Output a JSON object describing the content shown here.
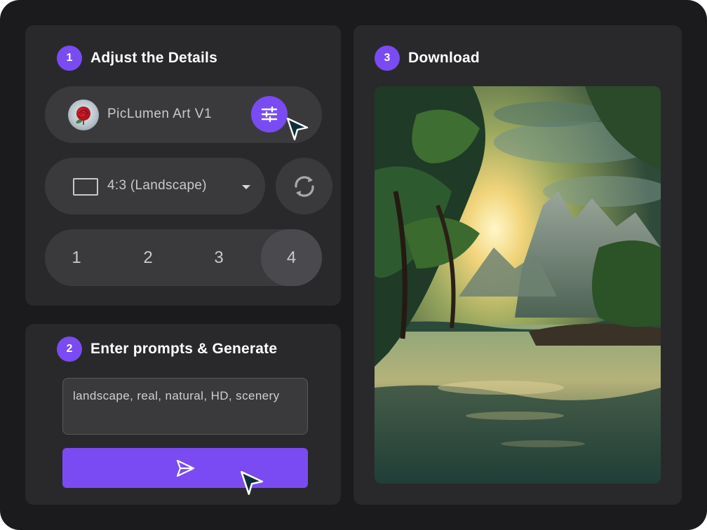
{
  "steps": {
    "step1": {
      "number": "1",
      "title": "Adjust the Details"
    },
    "step2": {
      "number": "2",
      "title": "Enter prompts & Generate"
    },
    "step3": {
      "number": "3",
      "title": "Download"
    }
  },
  "model": {
    "name": "PicLumen Art V1",
    "icon": "rose-avatar",
    "settings_icon": "sliders-icon"
  },
  "aspect_ratio": {
    "selected": "4:3 (Landscape)",
    "icon": "aspect-ratio-icon"
  },
  "refresh_icon": "refresh-icon",
  "image_count": {
    "options": [
      "1",
      "2",
      "3",
      "4"
    ],
    "selected": "4"
  },
  "prompt": {
    "value": "landscape, real, natural, HD, scenery"
  },
  "generate": {
    "icon": "send-icon"
  },
  "colors": {
    "accent": "#7a4bf2",
    "panel": "#29292b",
    "background": "#1b1b1d",
    "control": "#3a3a3d"
  }
}
